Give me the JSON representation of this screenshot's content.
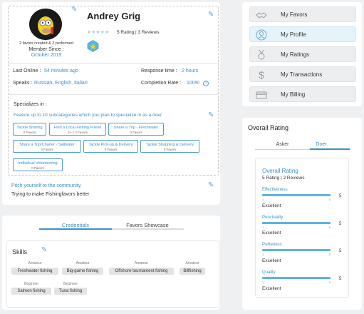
{
  "profile": {
    "name": "Andrey Grig",
    "favors_line": "2 favors created & 2 performed",
    "member_since_label": "Member Since :",
    "member_since_value": "October 2019",
    "stars": "★★★★★",
    "rating_summary": "5 Rating | 3 Reviews",
    "last_online_label": "Last Online :",
    "last_online_value": "54 minutes ago",
    "response_time_label": "Response time :",
    "response_time_value": "2 hours",
    "speaks_label": "Speaks :",
    "speaks_value": "Russian, English, Italian",
    "completion_rate_label": "Completion Rate :",
    "completion_rate_value": "100%",
    "help_glyph": "?"
  },
  "specialize": {
    "heading": "Specializes in :",
    "prompt": "Feature up to 10 subcategories which you plan to specialize in as a doer.",
    "subcategories": [
      {
        "title": "Tackle Sharing",
        "count": "0 Favors"
      },
      {
        "title": "Find a Local Fishing Friend",
        "count": "3 • 1 2 Favors"
      },
      {
        "title": "Share a Trip - Freshwater",
        "count": "0 Favors"
      },
      {
        "title": "Share a Trip/Charter - Saltwater",
        "count": "0 Favors"
      },
      {
        "title": "Tackle Pick-up & Delivery",
        "count": "0 Favors"
      },
      {
        "title": "Tackle Shopping & Delivery",
        "count": "0 Favors"
      },
      {
        "title": "Individual Volunteering",
        "count": "0 Favors"
      }
    ]
  },
  "pitch": {
    "prompt": "Pitch yourself to the community.",
    "text": "Trying to make Fishingfavors better"
  },
  "tabs": {
    "credentials": "Credentials",
    "showcase": "Favors Showcase"
  },
  "skills": {
    "heading": "Skills",
    "items": [
      {
        "level": "Amateur",
        "name": "Freshwater fishing"
      },
      {
        "level": "Amateur",
        "name": "Big-game fishing"
      },
      {
        "level": "Amateur",
        "name": "Offshore tournament fishing"
      },
      {
        "level": "Amateur",
        "name": "Billfishing"
      },
      {
        "level": "Beginner",
        "name": "Salmon fishing"
      },
      {
        "level": "Beginner",
        "name": "Tuna fishing"
      }
    ]
  },
  "menu": {
    "items": [
      {
        "label": "My Favors",
        "icon": "handshake-icon"
      },
      {
        "label": "My Profile",
        "icon": "user-circle-icon"
      },
      {
        "label": "My Ratings",
        "icon": "medal-icon"
      },
      {
        "label": "My Transactions",
        "icon": "dollar-icon"
      },
      {
        "label": "My Billing",
        "icon": "credit-card-icon"
      }
    ]
  },
  "overall": {
    "heading": "Overall Rating",
    "tab_asker": "Asker",
    "tab_doer": "Doer",
    "inner_title": "Overall Rating",
    "inner_summary": "5 Rating | 2 Reviews",
    "tick_min": "1",
    "tick_max": "5",
    "categories": [
      {
        "name": "Effectiveness",
        "value": "5",
        "word": "Excellent",
        "score": 5
      },
      {
        "name": "Punctuality",
        "value": "5",
        "word": "Excellent",
        "score": 5
      },
      {
        "name": "Politeness",
        "value": "5",
        "word": "Excellent",
        "score": 5
      },
      {
        "name": "Quality",
        "value": "5",
        "word": "Excellent",
        "score": 5
      }
    ]
  },
  "colors": {
    "accent": "#3a8fc7",
    "bar": "#5fb3de",
    "avatar_bg": "#1a1a1a"
  }
}
